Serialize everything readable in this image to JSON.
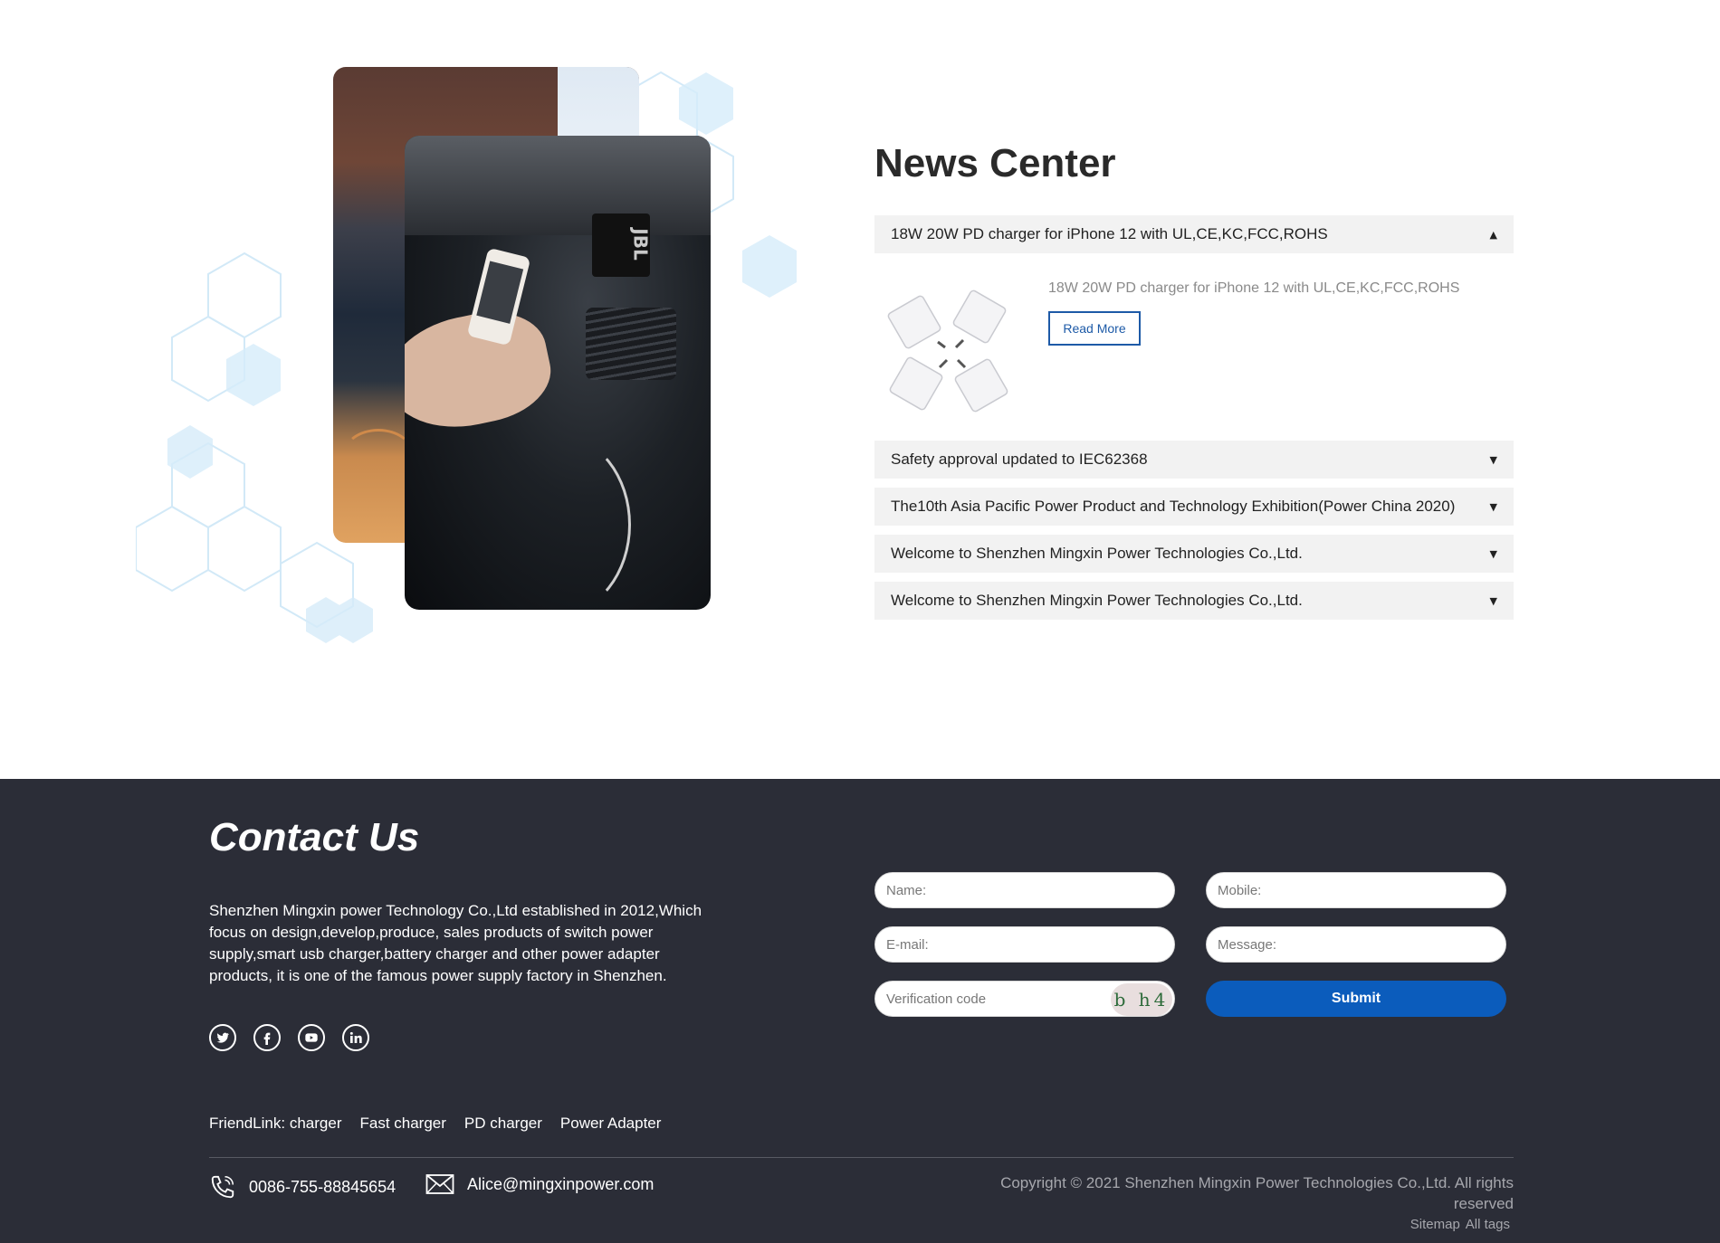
{
  "news": {
    "title": "News Center",
    "items": [
      {
        "label": "18W 20W PD charger for iPhone 12 with UL,CE,KC,FCC,ROHS",
        "expanded": true,
        "description": "18W 20W PD charger for iPhone 12 with UL,CE,KC,FCC,ROHS",
        "button": "Read More"
      },
      {
        "label": "Safety approval updated to IEC62368",
        "expanded": false
      },
      {
        "label": "The10th Asia Pacific Power Product and Technology Exhibition(Power China 2020)",
        "expanded": false
      },
      {
        "label": "Welcome to Shenzhen Mingxin Power Technologies Co.,Ltd.",
        "expanded": false
      },
      {
        "label": "Welcome to Shenzhen Mingxin Power Technologies Co.,Ltd.",
        "expanded": false
      }
    ]
  },
  "contact": {
    "title": "Contact Us",
    "text": "Shenzhen Mingxin power Technology Co.,Ltd established in 2012,Which focus on design,develop,produce, sales products of switch power supply,smart usb charger,battery charger and other power adapter products, it is one of the famous power supply factory in Shenzhen.",
    "socials": [
      "twitter-icon",
      "facebook-icon",
      "youtube-icon",
      "linkedin-icon"
    ],
    "form": {
      "name_placeholder": "Name:",
      "mobile_placeholder": "Mobile:",
      "email_placeholder": "E-mail:",
      "message_placeholder": "Message:",
      "verification_placeholder": "Verification code",
      "captcha": "b h4",
      "submit_label": "Submit"
    }
  },
  "footer": {
    "friendlink_label": "FriendLink:",
    "friendlinks": [
      "charger",
      "Fast charger",
      "PD charger",
      "Power Adapter"
    ],
    "phone": "0086-755-88845654",
    "email": "Alice@mingxinpower.com",
    "copyright": "Copyright © 2021 Shenzhen Mingxin Power Technologies Co.,Ltd. All rights reserved",
    "sitemap": "Sitemap",
    "all_tags": "All tags"
  },
  "colors": {
    "footer_bg": "#2b2d37",
    "accent_blue": "#0b5cbc",
    "accordion_bg": "#f2f2f2"
  }
}
